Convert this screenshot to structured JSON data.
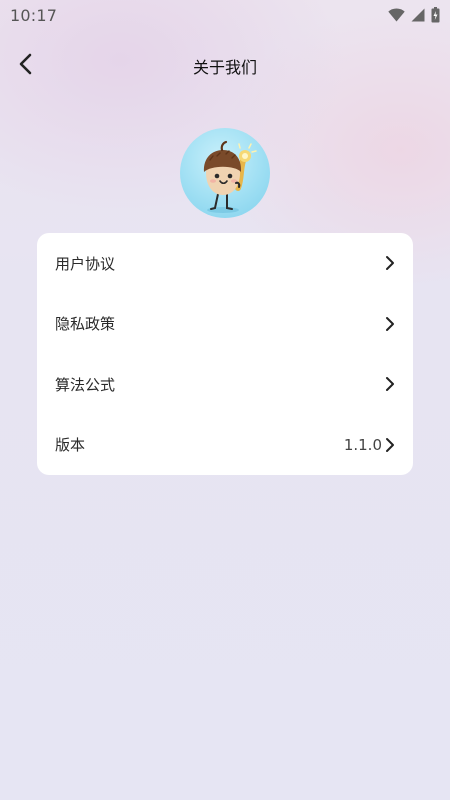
{
  "status_bar": {
    "time": "10:17",
    "icons": [
      "wifi-icon",
      "signal-icon",
      "battery-icon"
    ]
  },
  "nav": {
    "title": "关于我们",
    "back_icon": "chevron-left-icon"
  },
  "avatar": {
    "icon": "app-mascot-logo"
  },
  "menu": {
    "items": [
      {
        "label": "用户协议",
        "value": ""
      },
      {
        "label": "隐私政策",
        "value": ""
      },
      {
        "label": "算法公式",
        "value": ""
      },
      {
        "label": "版本",
        "value": "1.1.0"
      }
    ]
  },
  "colors": {
    "card_bg": "#ffffff",
    "text": "#2a2a2a",
    "avatar_bg": "#9fdff3"
  }
}
